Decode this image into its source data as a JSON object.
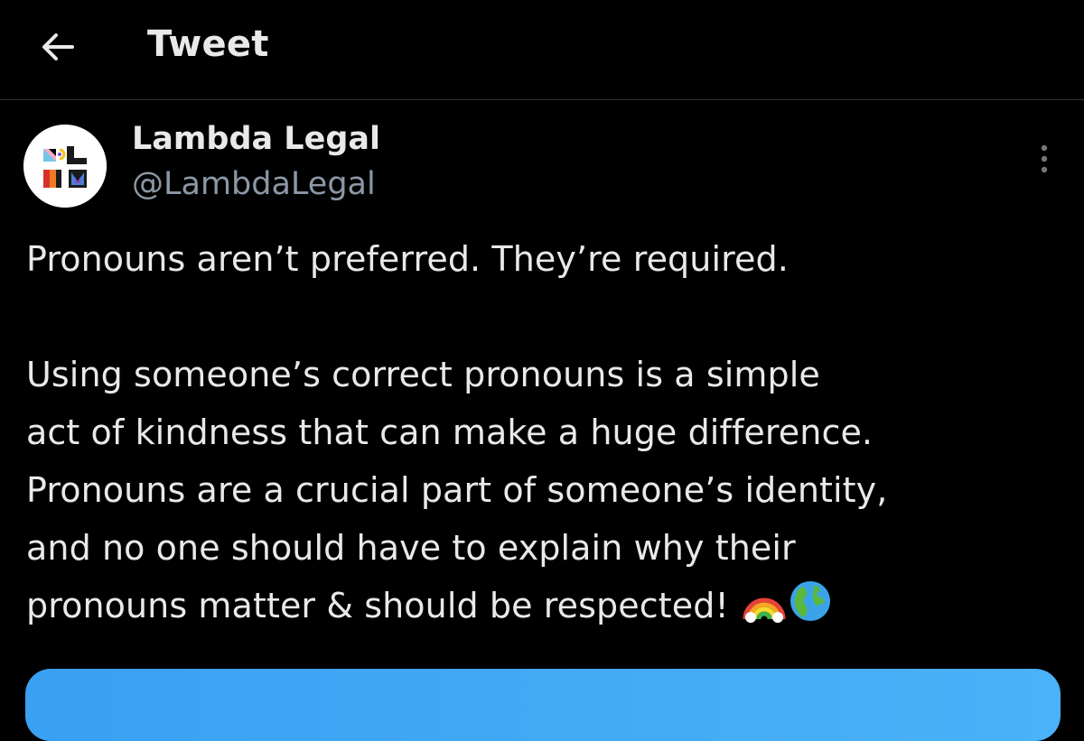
{
  "header": {
    "title": "Tweet",
    "back_icon": "arrow-left-icon"
  },
  "tweet": {
    "author": {
      "display_name": "Lambda Legal",
      "handle": "@LambdaLegal",
      "avatar_icon": "lambda-legal-logo"
    },
    "more_icon": "more-vertical-icon",
    "text_lines": [
      "Pronouns aren’t preferred. They’re required.",
      "Using someone’s correct pronouns is a simple",
      "act of kindness that can make a huge difference.",
      "Pronouns are a crucial part of someone’s identity,",
      "and no one should have to explain why their",
      "pronouns matter & should be respected!"
    ],
    "emojis": [
      "rainbow-emoji",
      "globe-emoji"
    ]
  },
  "colors": {
    "background": "#000000",
    "text": "#e7e9ea",
    "secondary_text": "#8b98a5",
    "divider": "#2f3336",
    "media_accent": "#3aa0f2"
  }
}
